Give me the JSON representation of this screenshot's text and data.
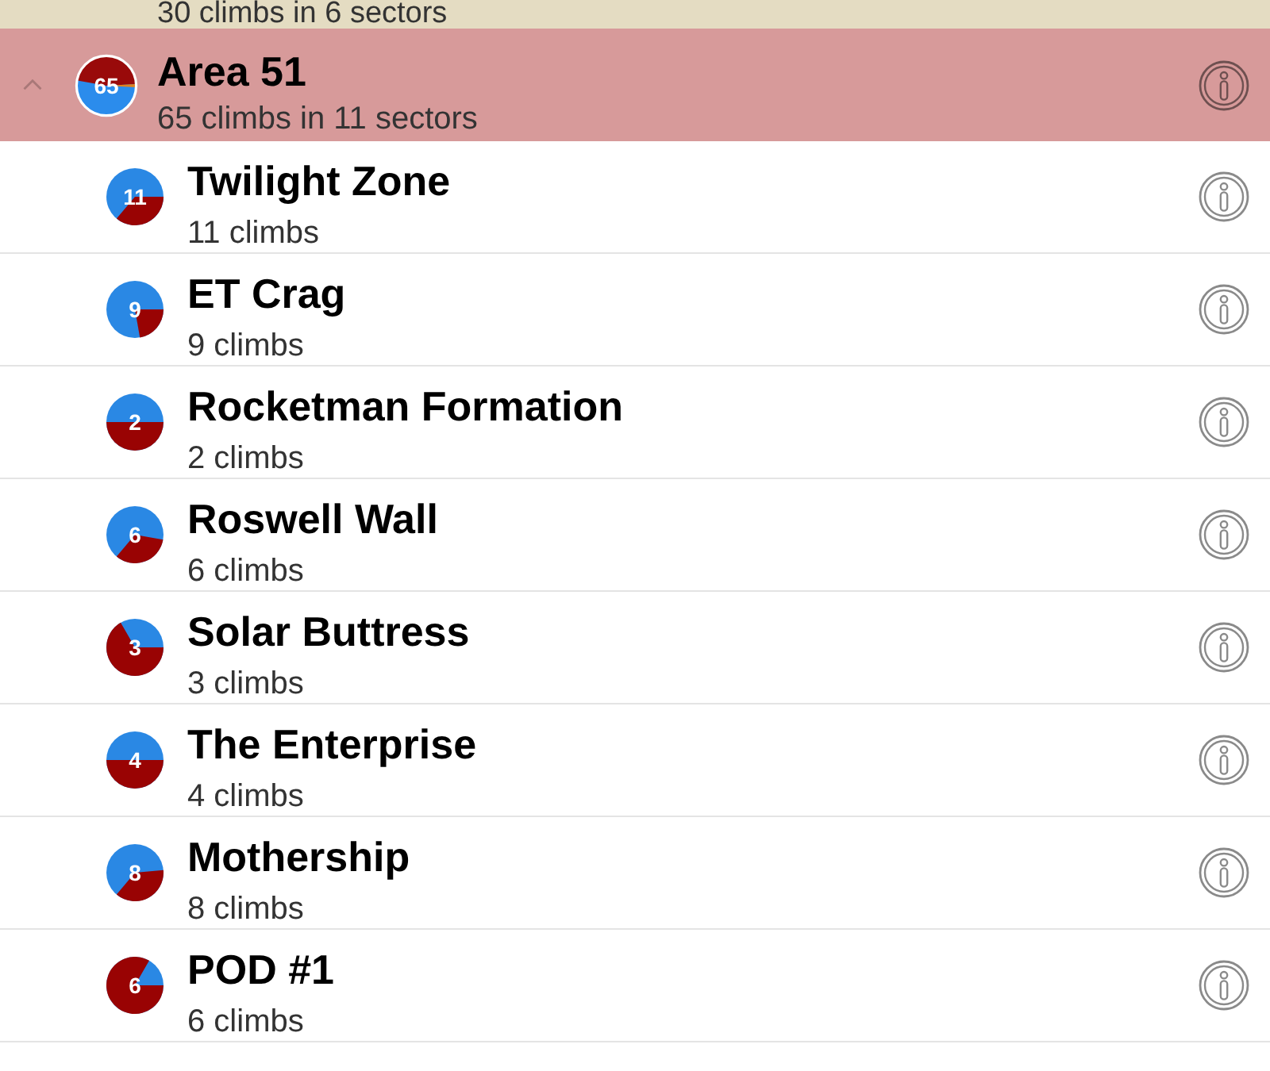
{
  "areas": [
    {
      "subtitle": "30 climbs in 6 sectors",
      "color": "#e4dcc2"
    },
    {
      "title": "Area 51",
      "subtitle": "65 climbs in 11 sectors",
      "color": "#d79a9a",
      "expanded": true,
      "badge": "65",
      "children": [
        {
          "name": "Twilight Zone",
          "subtitle": "11 climbs",
          "badge": "11"
        },
        {
          "name": "ET Crag",
          "subtitle": "9 climbs",
          "badge": "9"
        },
        {
          "name": "Rocketman Formation",
          "subtitle": "2 climbs",
          "badge": "2"
        },
        {
          "name": "Roswell Wall",
          "subtitle": "6 climbs",
          "badge": "6"
        },
        {
          "name": "Solar Buttress",
          "subtitle": "3 climbs",
          "badge": "3"
        },
        {
          "name": "The Enterprise",
          "subtitle": "4 climbs",
          "badge": "4"
        },
        {
          "name": "Mothership",
          "subtitle": "8 climbs",
          "badge": "8"
        },
        {
          "name": "POD #1",
          "subtitle": "6 climbs",
          "badge": "6"
        }
      ]
    }
  ]
}
